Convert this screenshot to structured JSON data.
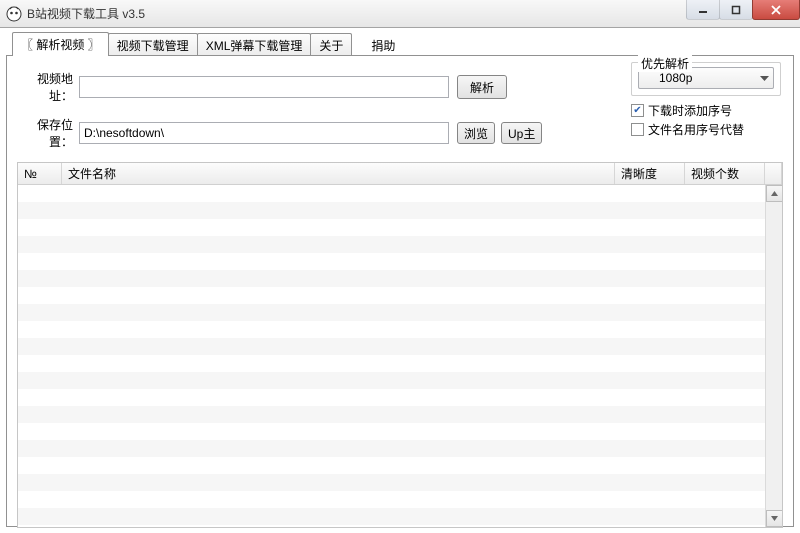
{
  "window": {
    "title": "B站视频下载工具 v3.5"
  },
  "tabs": {
    "parse": "〖 解析视频 〗",
    "dlmgr": "视频下载管理",
    "xmlmgr": "XML弹幕下载管理",
    "about": "关于",
    "donate": "捐助"
  },
  "form": {
    "url_label": "视频地址：",
    "url_value": "",
    "parse_btn": "解析",
    "path_label": "保存位置：",
    "path_value": "D:\\nesoftdown\\",
    "browse_btn": "浏览",
    "up_btn": "Up主"
  },
  "priority": {
    "legend": "优先解析",
    "selected": "1080p"
  },
  "options": {
    "add_seq": {
      "label": "下载时添加序号",
      "checked": true
    },
    "name_seq": {
      "label": "文件名用序号代替",
      "checked": false
    }
  },
  "grid": {
    "cols": {
      "no": "№",
      "name": "文件名称",
      "quality": "清晰度",
      "count": "视频个数"
    },
    "rows": []
  }
}
